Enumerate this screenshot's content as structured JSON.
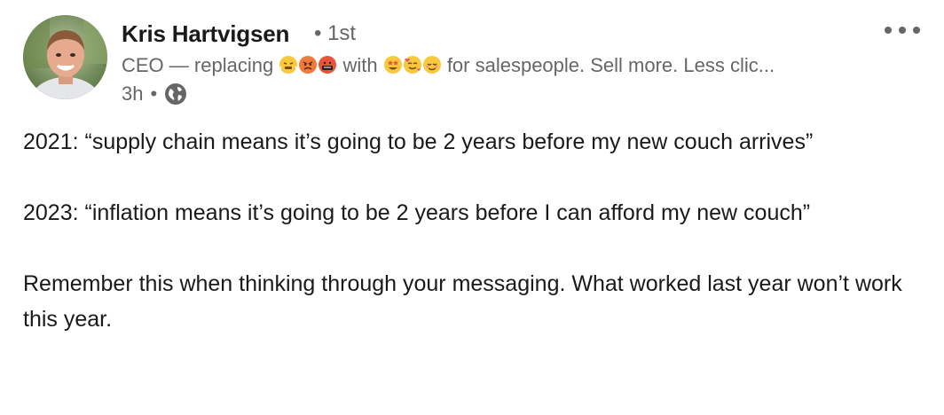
{
  "post": {
    "author": {
      "name": "Kris Hartvigsen",
      "degree": "• 1st",
      "headline_before": "CEO — replacing",
      "headline_mid": "with",
      "headline_after": "for salespeople. Sell more. Less clic...",
      "time": "3h",
      "visibility_sep": "•",
      "visibility_icon": "globe-icon",
      "avatar_icon": "avatar"
    },
    "more_icon": "ellipsis-icon",
    "paragraphs": [
      "2021: “supply chain means it’s going to be 2 years before my new couch arrives”",
      "2023: “inflation means it’s going to be 2 years before I can afford my new couch”",
      "Remember this when thinking through your messaging. What worked last year won’t work this year."
    ]
  }
}
